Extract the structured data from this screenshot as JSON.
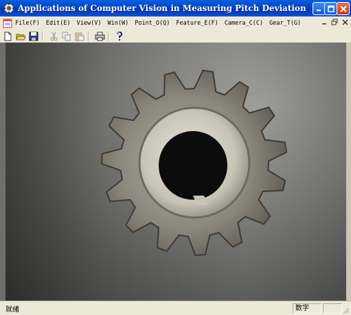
{
  "window": {
    "title": "Applications of Computer Vision in Measuring Pitch Deviation of..."
  },
  "menu": {
    "items": [
      {
        "label": "File(F)"
      },
      {
        "label": "Edit(E)"
      },
      {
        "label": "View(V)"
      },
      {
        "label": "Win(W)"
      },
      {
        "label": "Point_O(Q)"
      },
      {
        "label": "Feature_E(F)"
      },
      {
        "label": "Camera_C(C)"
      },
      {
        "label": "Gear_T(G)"
      }
    ],
    "mdi_controls": {
      "minimize": "_",
      "restore": "͈",
      "close": "x"
    }
  },
  "toolbar": {
    "tools": [
      "new-icon",
      "open-icon",
      "save-icon",
      "cut-icon",
      "copy-icon",
      "paste-icon",
      "print-icon",
      "help-icon"
    ]
  },
  "canvas": {
    "content": "gear-image"
  },
  "status": {
    "text": "就绪",
    "num_indicator": "数字"
  },
  "colors": {
    "titlebar": "#0343c9",
    "chrome": "#ece9d8"
  }
}
